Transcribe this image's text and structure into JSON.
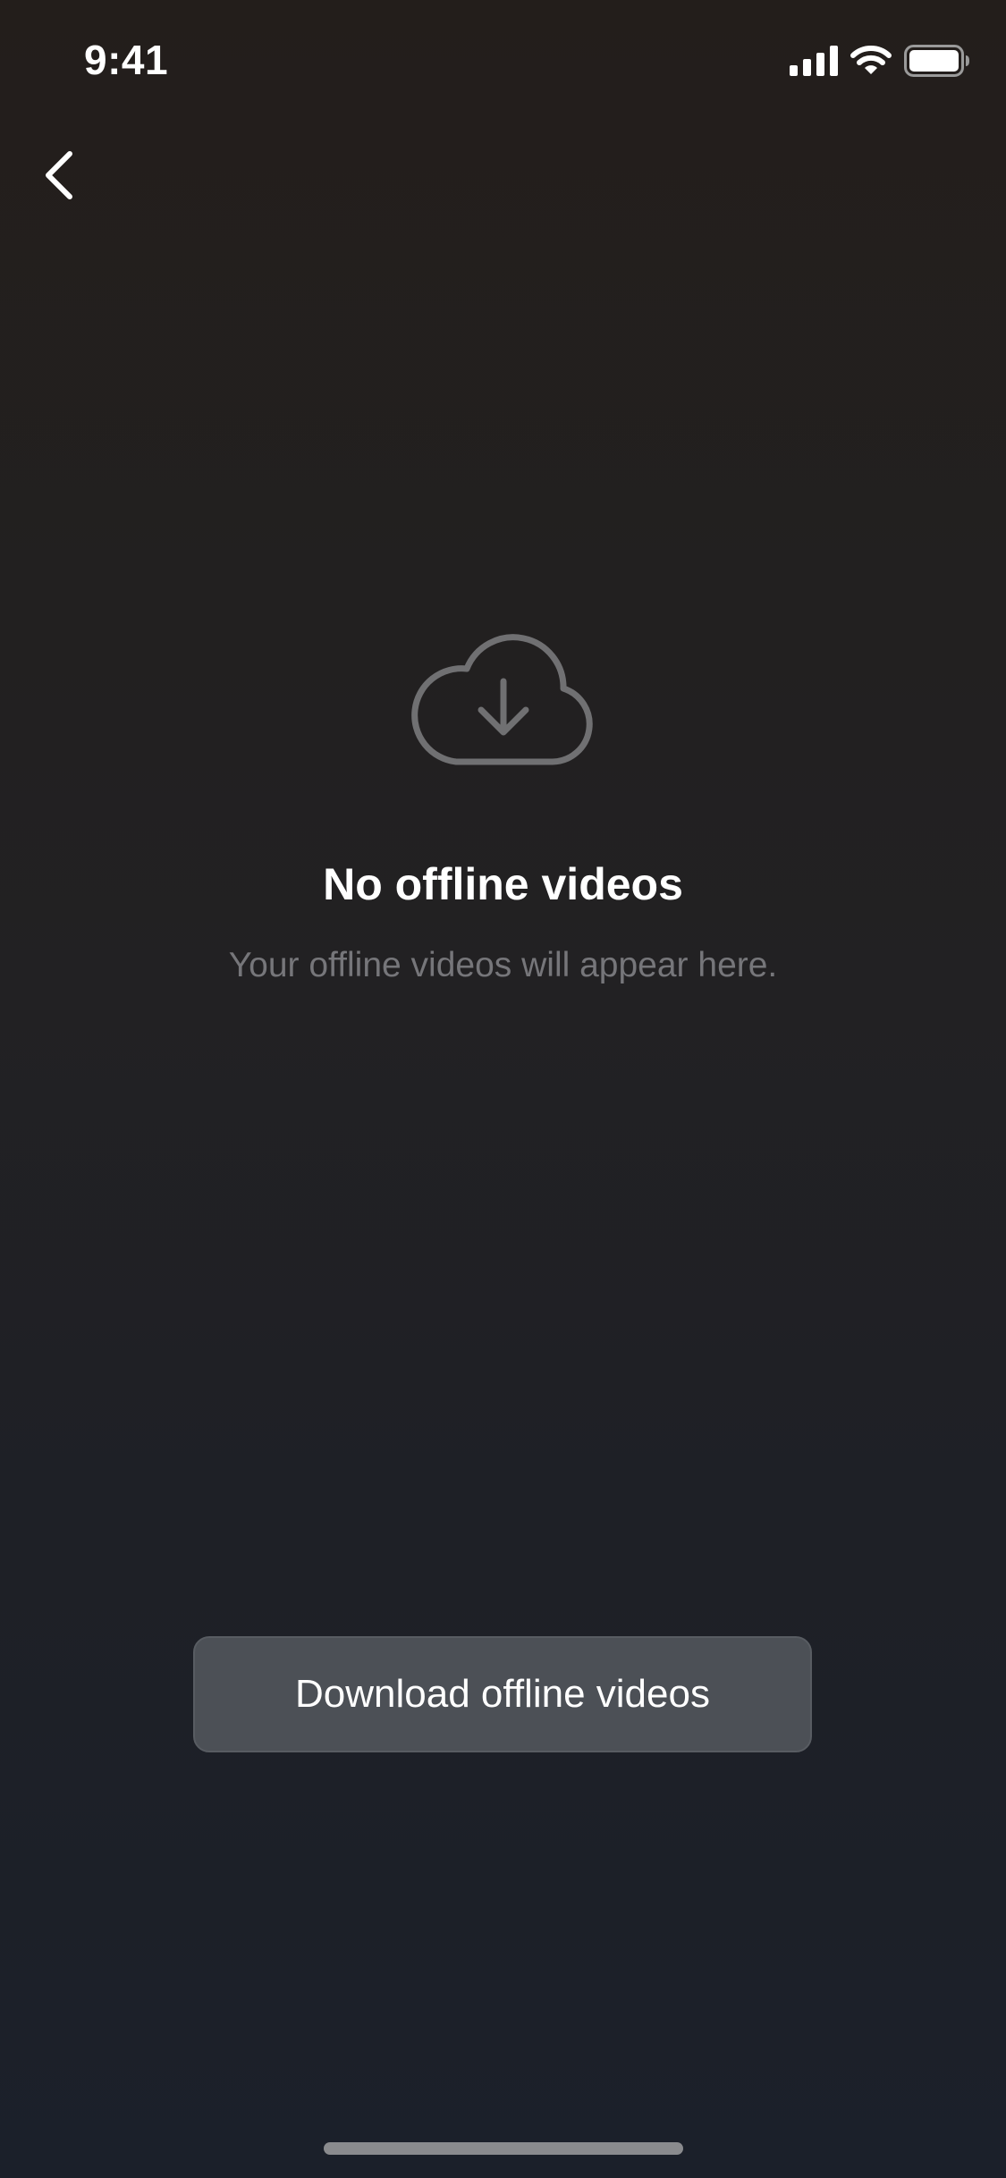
{
  "status_bar": {
    "time": "9:41",
    "icons": [
      "cellular-signal-icon",
      "wifi-icon",
      "battery-icon"
    ]
  },
  "nav": {
    "back_icon": "chevron-left-icon"
  },
  "empty_state": {
    "icon": "cloud-download-icon",
    "title": "No offline videos",
    "subtitle": "Your offline videos will appear here."
  },
  "actions": {
    "download_label": "Download offline videos"
  },
  "colors": {
    "background_top": "#231e1b",
    "background_bottom": "#1b202a",
    "button_bg": "#4c5056",
    "subtitle_text": "#76767a",
    "icon_stroke": "#707072"
  }
}
